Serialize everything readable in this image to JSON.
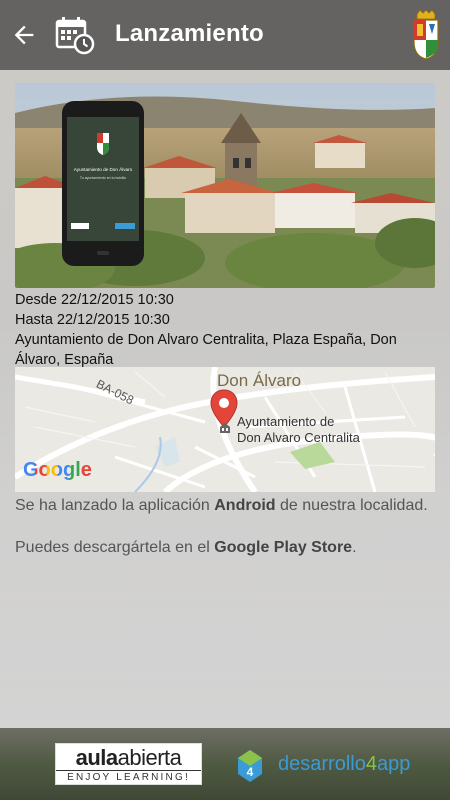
{
  "appbar": {
    "title": "Lanzamiento",
    "back_icon": "arrow-left-icon",
    "calendar_icon": "calendar-clock-icon",
    "crest_icon": "coat-of-arms-icon"
  },
  "hero": {
    "phone_screen_title": "Ayuntamiento de Don Álvaro",
    "phone_screen_subtitle": "Tu ayuntamiento en tu bolsillo"
  },
  "event": {
    "start": "Desde 22/12/2015 10:30",
    "end": "Hasta 22/12/2015 10:30",
    "address": "Ayuntamiento de Don Alvaro Centralita, Plaza España, Don Álvaro, España"
  },
  "map": {
    "town_label": "Don Álvaro",
    "road_label": "BA-058",
    "marker_label_line1": "Ayuntamiento de",
    "marker_label_line2": "Don Alvaro Centralita",
    "provider": "Google"
  },
  "description": {
    "p1_before": "Se ha lanzado la aplicación ",
    "p1_bold": "Android",
    "p1_after": " de nuestra localidad.",
    "p2_before": "Puedes descargártela en el ",
    "p2_bold": "Google Play Store",
    "p2_after": "."
  },
  "footer": {
    "aula_main_1": "aula",
    "aula_main_2": "abierta",
    "aula_sub": "ENJOY LEARNING!",
    "d4a_part1": "desarrollo",
    "d4a_part2": "4",
    "d4a_part3": "app"
  },
  "colors": {
    "appbar": "#3c3c3c",
    "map_marker": "#e2463a",
    "brand_blue": "#3a9bd5",
    "brand_green": "#8bc34a"
  }
}
